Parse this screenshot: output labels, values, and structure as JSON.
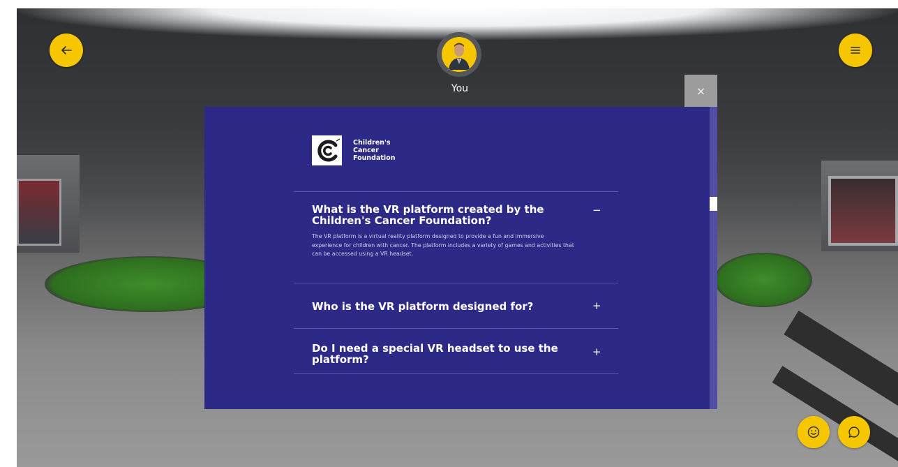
{
  "header": {
    "user_label": "You"
  },
  "modal": {
    "close_label": "×",
    "logo": {
      "line1": "Children's",
      "line2": "Cancer",
      "line3": "Foundation"
    },
    "faq": [
      {
        "question": "What is the VR platform created by the Children's Cancer Foundation?",
        "toggle": "−",
        "expanded": true,
        "answer": "The VR platform is a virtual reality platform designed to provide a fun and immersive experience for children with cancer. The platform includes a variety of games and activities that can be accessed using a VR headset."
      },
      {
        "question": "Who is the VR platform designed for?",
        "toggle": "+",
        "expanded": false
      },
      {
        "question": "Do I need a special VR headset to use the platform?",
        "toggle": "+",
        "expanded": false
      }
    ]
  },
  "icons": {
    "back": "arrow-left-icon",
    "menu": "hamburger-menu-icon",
    "emoji": "smiley-icon",
    "chat": "chat-bubble-icon"
  },
  "colors": {
    "accent_yellow": "#f6c700",
    "modal_bg": "#2c2a86",
    "scrollbar": "#524ea5",
    "close_bg": "#9c9c9c"
  }
}
